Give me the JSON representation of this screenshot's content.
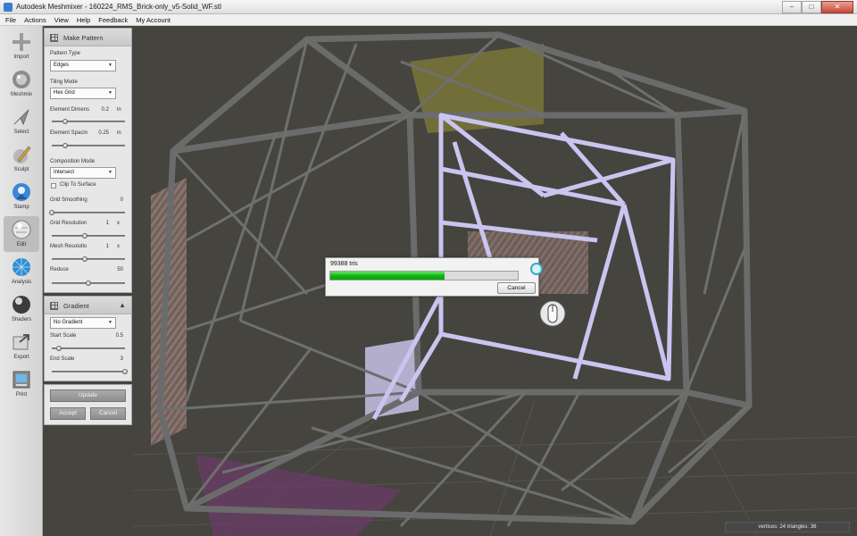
{
  "window": {
    "title": "Autodesk Meshmixer - 160224_RMS_Brick-only_v5-Solid_WF.stl"
  },
  "menu": [
    "File",
    "Actions",
    "View",
    "Help",
    "Feedback",
    "My Account"
  ],
  "tools": [
    {
      "label": "Import",
      "icon": "plus-icon"
    },
    {
      "label": "Meshmix",
      "icon": "meshmix-icon"
    },
    {
      "label": "Select",
      "icon": "select-arrow-icon"
    },
    {
      "label": "Sculpt",
      "icon": "sculpt-brush-icon"
    },
    {
      "label": "Stamp",
      "icon": "stamp-icon"
    },
    {
      "label": "Edit",
      "icon": "edit-sphere-icon"
    },
    {
      "label": "Analysis",
      "icon": "analysis-globe-icon"
    },
    {
      "label": "Shaders",
      "icon": "shader-sphere-icon"
    },
    {
      "label": "Export",
      "icon": "export-arrow-icon"
    },
    {
      "label": "Print",
      "icon": "print-icon"
    }
  ],
  "make_pattern": {
    "title": "Make Pattern",
    "pattern_type": {
      "label": "Pattern Type",
      "value": "Edges"
    },
    "tiling_mode": {
      "label": "Tiling Mode",
      "value": "Hex Grid"
    },
    "element_dimens": {
      "label": "Element Dimens",
      "value": "0.2",
      "unit": "in",
      "fraction": 0.18
    },
    "element_spacing": {
      "label": "Element Spacin",
      "value": "0.25",
      "unit": "in",
      "fraction": 0.18
    },
    "composition_mode": {
      "label": "Composition Mode",
      "value": "Intersect"
    },
    "clip_to_surface": {
      "label": "Clip To Surface",
      "checked": false
    },
    "grid_smoothing": {
      "label": "Grid Smoothing",
      "value": "0",
      "fraction": 0.0
    },
    "grid_resolution": {
      "label": "Grid Resolution",
      "value": "1",
      "unit": "x",
      "fraction": 0.45
    },
    "mesh_resolution": {
      "label": "Mesh Resolutio",
      "value": "1",
      "unit": "x",
      "fraction": 0.45
    },
    "reduce": {
      "label": "Reduce",
      "value": "50",
      "fraction": 0.5
    }
  },
  "gradient": {
    "title": "Gradient",
    "mode": "No Gradient",
    "start_scale": {
      "label": "Start Scale",
      "value": "0.5",
      "fraction": 0.1
    },
    "end_scale": {
      "label": "End Scale",
      "value": "3",
      "fraction": 1.0
    }
  },
  "actions": {
    "update": "Update",
    "accept": "Accept",
    "cancel": "Cancel"
  },
  "progress": {
    "label": "99388 tris",
    "fraction": 0.61,
    "cancel": "Cancel"
  },
  "status": "vertices: 24 triangles: 36",
  "colors": {
    "progress_green": "#12b812",
    "wire_gray": "#6b6b6b",
    "highlight_lavender": "#c9c5ef",
    "background": "#45443f"
  }
}
